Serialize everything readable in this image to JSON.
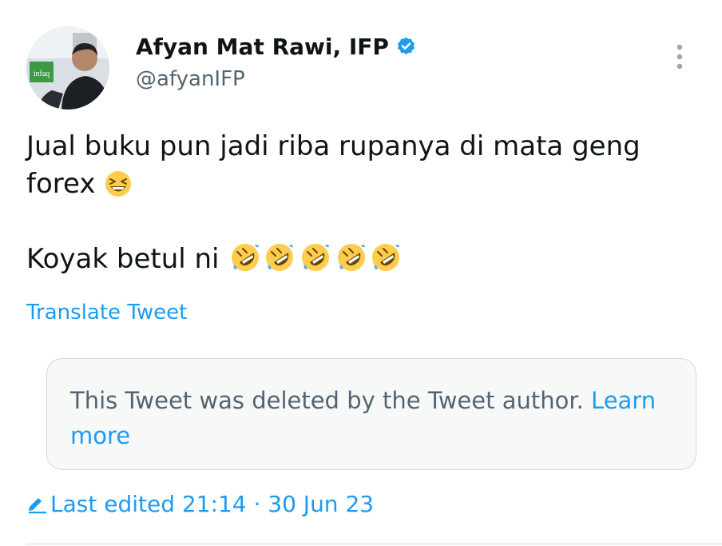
{
  "author": {
    "display_name": "Afyan Mat Rawi, IFP",
    "handle": "@afyanIFP",
    "avatar_logo_text": "infaq",
    "verified": true
  },
  "tweet": {
    "line1": "Jual buku pun jadi riba rupanya di mata geng",
    "line2": "forex",
    "line3": "Koyak betul ni",
    "translate_label": "Translate Tweet"
  },
  "quoted": {
    "deleted_message": "This Tweet was deleted by the Tweet author.",
    "learn_more_label": "Learn more"
  },
  "meta": {
    "edited_label": "Last edited 21:14 · 30 Jun 23"
  },
  "icons": [
    "verified-badge-icon",
    "more-options-icon",
    "grinning-squinting-face-emoji",
    "rolling-on-floor-laughing-emoji",
    "edit-pencil-icon"
  ],
  "colors": {
    "accent": "#1d9bf0",
    "text": "#0f1419",
    "secondary": "#536471",
    "border": "#cfd9de"
  }
}
